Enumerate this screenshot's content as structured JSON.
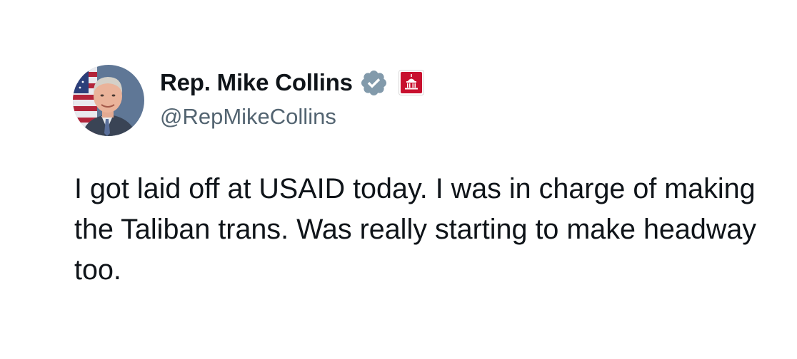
{
  "author": {
    "display_name": "Rep. Mike Collins",
    "handle": "@RepMikeCollins",
    "avatar_icon": "profile-photo",
    "verified_icon": "verified-badge-icon",
    "affiliation_icon": "us-capitol-affiliation-icon"
  },
  "tweet": {
    "text": "I got laid off at USAID today. I was in charge of making the Taliban trans. Was really starting to make headway too."
  },
  "colors": {
    "text": "#0f1419",
    "secondary_text": "#536471",
    "verified_badge": "#829aab",
    "affiliation_badge": "#c8102e"
  }
}
